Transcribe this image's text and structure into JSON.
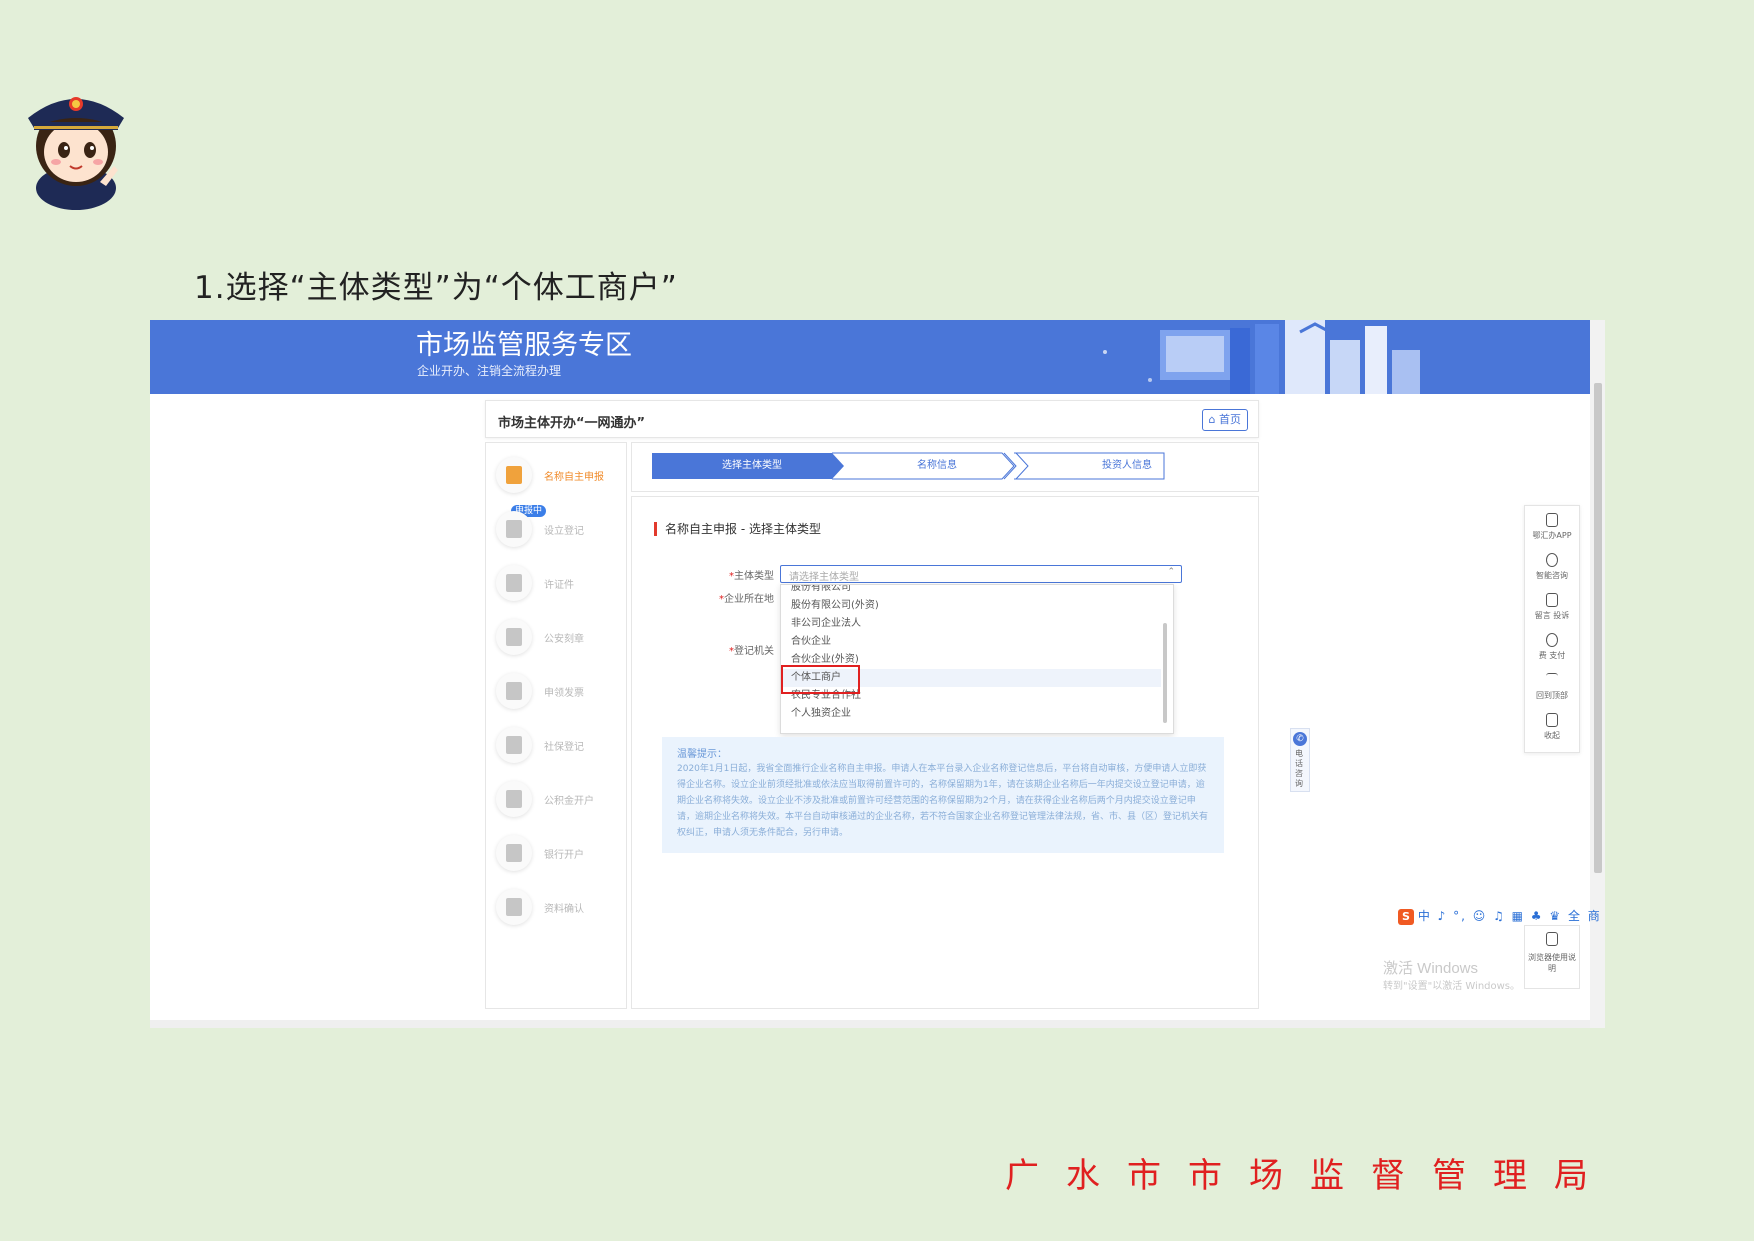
{
  "caption": "1.选择“主体类型”为“个体工商户”",
  "footer_org": "广水市市场监督管理局",
  "portal": {
    "title": "市场监管服务专区",
    "subtitle": "企业开办、注销全流程办理"
  },
  "card_header": {
    "title": "市场主体开办“一网通办”",
    "home_label": "首页"
  },
  "left_nav": {
    "badge": "申报中",
    "items": [
      {
        "label": "名称自主申报",
        "icon": "edit-icon",
        "active": true
      },
      {
        "label": "设立登记",
        "icon": "form-icon",
        "active": false
      },
      {
        "label": "许证件",
        "icon": "id-card-icon",
        "active": false
      },
      {
        "label": "公安刻章",
        "icon": "stamp-icon",
        "active": false
      },
      {
        "label": "申领发票",
        "icon": "invoice-icon",
        "active": false
      },
      {
        "label": "社保登记",
        "icon": "shield-icon",
        "active": false
      },
      {
        "label": "公积金开户",
        "icon": "house-icon",
        "active": false
      },
      {
        "label": "银行开户",
        "icon": "bank-icon",
        "active": false
      },
      {
        "label": "资料确认",
        "icon": "document-icon",
        "active": false
      }
    ]
  },
  "steps": [
    "选择主体类型",
    "名称信息",
    "投资人信息"
  ],
  "form": {
    "section_title": "名称自主申报 - 选择主体类型",
    "label_entity_type": "主体类型",
    "label_location": "企业所在地",
    "label_registration_authority": "登记机关",
    "placeholder": "请选择主体类型",
    "options": [
      "股份有限公司",
      "股份有限公司(外资)",
      "非公司企业法人",
      "合伙企业",
      "合伙企业(外资)",
      "个体工商户",
      "农民专业合作社",
      "个人独资企业"
    ],
    "highlighted_option": "个体工商户"
  },
  "tips": {
    "title": "温馨提示：",
    "body": "2020年1月1日起，我省全面推行企业名称自主申报。申请人在本平台录入企业名称登记信息后，平台将自动审核，方便申请人立即获得企业名称。设立企业前须经批准或依法应当取得前置许可的，名称保留期为1年，请在该期企业名称后一年内提交设立登记申请，逾期企业名称将失效。设立企业不涉及批准或前置许可经营范围的名称保留期为2个月，请在获得企业名称后两个月内提交设立登记申请，逾期企业名称将失效。本平台自动审核通过的企业名称，若不符合国家企业名称登记管理法律法规，省、市、县（区）登记机关有权纠正，申请人须无条件配合，另行申请。"
  },
  "phone_tab": "电话咨询",
  "right_bar": [
    {
      "label": "鄂汇办APP",
      "icon": "mobile-icon"
    },
    {
      "label": "智能咨询",
      "icon": "headset-icon"
    },
    {
      "label": "留言 投诉",
      "icon": "message-icon"
    },
    {
      "label": "费 支付",
      "icon": "yuan-icon"
    },
    {
      "label": "回到顶部",
      "icon": "arrow-up-icon"
    },
    {
      "label": "收起",
      "icon": "collapse-icon"
    }
  ],
  "help_bar_label": "浏览器使用说明",
  "ime_bar": "中 ♪ °, ☺ ♫ ▦ ♣ ♛ 全 商",
  "watermark": {
    "line1": "激活 Windows",
    "line2": "转到\"设置\"以激活 Windows。"
  },
  "colors": {
    "page_bg": "#e3efd9",
    "banner": "#4a76d8",
    "accent": "#4a76d8",
    "highlight_box": "#e02020",
    "footer_text": "#e02020"
  }
}
